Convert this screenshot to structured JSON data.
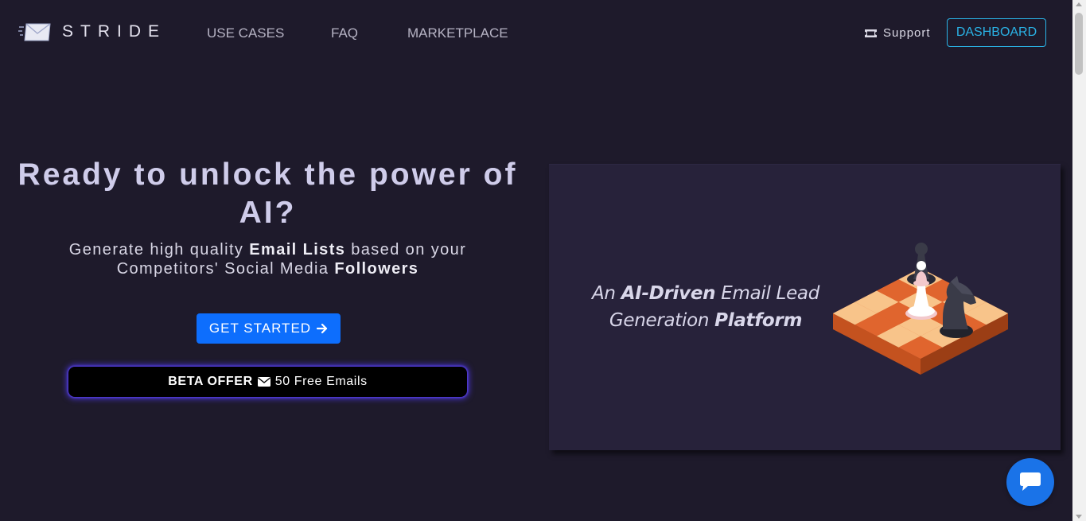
{
  "header": {
    "logo_text": "STRIDE",
    "nav": [
      {
        "label": "USE CASES"
      },
      {
        "label": "FAQ"
      },
      {
        "label": "MARKETPLACE"
      }
    ],
    "support_label": "Support",
    "dashboard_label": "DASHBOARD"
  },
  "hero": {
    "title": "Ready to unlock the power of AI?",
    "subtitle": {
      "part1": "Generate high quality ",
      "bold1": "Email Lists",
      "part2": " based on your Competitors' Social Media ",
      "bold2": "Followers"
    },
    "cta_label": "GET STARTED",
    "beta": {
      "label": "BETA OFFER",
      "text": "50 Free Emails"
    }
  },
  "card": {
    "tagline": {
      "part1": "An ",
      "bold1": "AI-Driven",
      "part2": " Email Lead Generation ",
      "bold2": "Platform"
    }
  },
  "colors": {
    "background": "#1e1a2b",
    "card": "#27223a",
    "accent_blue": "#0d6efd",
    "dashboard_border": "#2ab3e6",
    "beta_glow": "#4a35d8",
    "chess_orange": "#e0652e",
    "chess_light": "#f8c48a"
  },
  "icons": {
    "logo": "envelope-speed-icon",
    "support": "ticket-icon",
    "cta": "arrow-right-icon",
    "beta": "envelope-icon",
    "chat": "chat-bubble-icon"
  }
}
